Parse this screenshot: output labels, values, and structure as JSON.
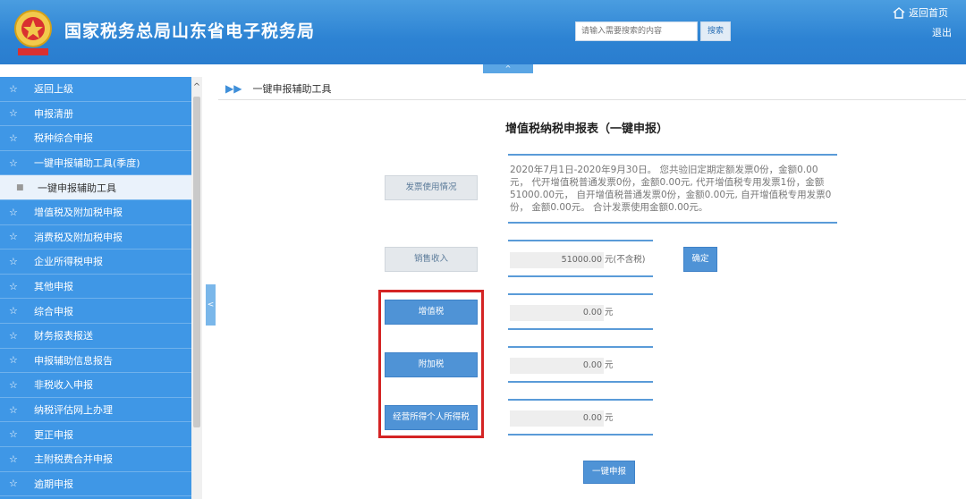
{
  "header": {
    "site_title": "国家税务总局山东省电子税务局",
    "search_placeholder": "请输入需要搜索的内容",
    "search_label": "搜索",
    "home_label": "返回首页",
    "logout_label": "退出",
    "collapse_symbol": "^"
  },
  "sidebar": {
    "items": [
      {
        "label": "返回上级"
      },
      {
        "label": "申报清册"
      },
      {
        "label": "税种综合申报"
      },
      {
        "label": "一键申报辅助工具(季度)"
      },
      {
        "label": "一键申报辅助工具"
      },
      {
        "label": "增值税及附加税申报"
      },
      {
        "label": "消费税及附加税申报"
      },
      {
        "label": "企业所得税申报"
      },
      {
        "label": "其他申报"
      },
      {
        "label": "综合申报"
      },
      {
        "label": "财务报表报送"
      },
      {
        "label": "申报辅助信息报告"
      },
      {
        "label": "非税收入申报"
      },
      {
        "label": "纳税评估网上办理"
      },
      {
        "label": "更正申报"
      },
      {
        "label": "主附税费合并申报"
      },
      {
        "label": "逾期申报"
      }
    ],
    "toggle_symbol": "<",
    "scroll_up": "^"
  },
  "breadcrumb": {
    "label": "一键申报辅助工具"
  },
  "form": {
    "title": "增值税纳税申报表（一键申报）",
    "info_text": "2020年7月1日-2020年9月30日。 您共验旧定期定额发票0份，金额0.00元， 代开增值税普通发票0份，金额0.00元, 代开增值税专用发票1份，金额51000.00元， 自开增值税普通发票0份，金额0.00元, 自开增值税专用发票0份， 金额0.00元。 合计发票使用金额0.00元。",
    "invoice_usage_label": "发票使用情况",
    "sales_income_label": "销售收入",
    "sales_amount": "51000.00",
    "sales_unit": "元(不含税)",
    "confirm_label": "确定",
    "vat_label": "增值税",
    "vat_amount": "0.00",
    "surtax_label": "附加税",
    "surtax_amount": "0.00",
    "personal_income_label": "经营所得个人所得税",
    "personal_income_amount": "0.00",
    "unit": "元",
    "submit_label": "一键申报"
  },
  "colors": {
    "header_blue": "#2d83d3",
    "sidebar_blue": "#3f97e6",
    "button_blue": "#4f93d6",
    "highlight_red": "#d42424"
  }
}
